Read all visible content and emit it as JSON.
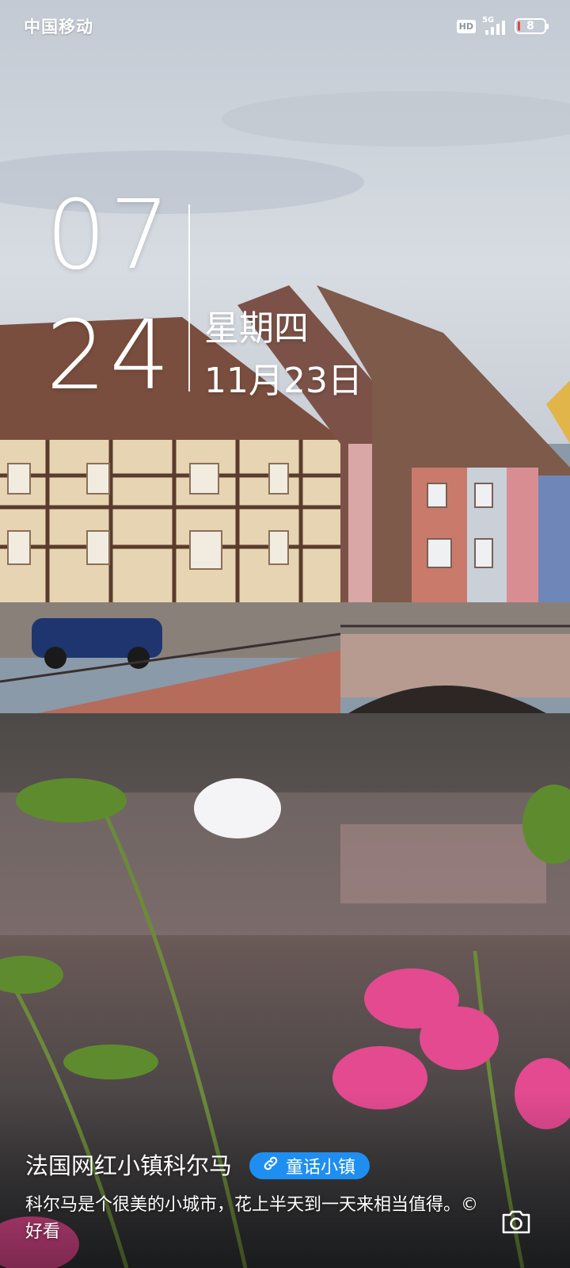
{
  "status_bar": {
    "carrier": "中国移动",
    "hd_label": "HD",
    "network_label": "5G",
    "battery_level": "8",
    "battery_percent": 8,
    "battery_color": "#e5483f"
  },
  "clock": {
    "hours": "07",
    "minutes": "24",
    "weekday": "星期四",
    "date": "11月23日"
  },
  "magazine": {
    "title": "法国网红小镇科尔马",
    "tag": "童话小镇",
    "tag_icon": "link-icon",
    "tag_color": "#1e8ff0",
    "description": "科尔马是个很美的小城市，花上半天到一天来相当值得。©好看"
  },
  "camera": {
    "icon": "camera-icon"
  }
}
